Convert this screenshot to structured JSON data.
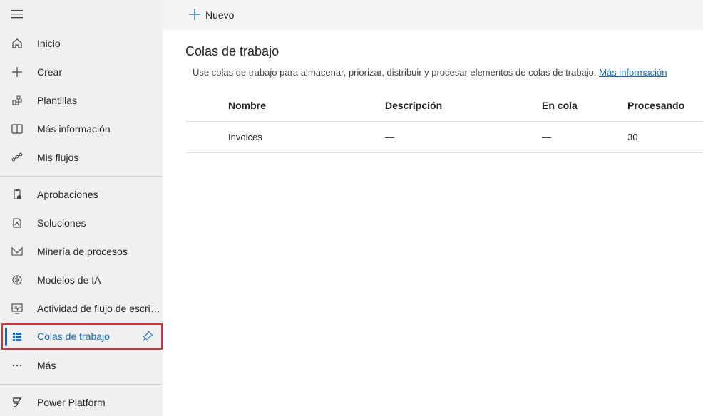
{
  "sidebar": {
    "items": [
      {
        "label": "Inicio",
        "icon": "home-icon"
      },
      {
        "label": "Crear",
        "icon": "plus-icon"
      },
      {
        "label": "Plantillas",
        "icon": "templates-icon"
      },
      {
        "label": "Más información",
        "icon": "book-icon"
      },
      {
        "label": "Mis flujos",
        "icon": "flow-icon"
      },
      {
        "label": "Aprobaciones",
        "icon": "approvals-icon"
      },
      {
        "label": "Soluciones",
        "icon": "solutions-icon"
      },
      {
        "label": "Minería de procesos",
        "icon": "process-mining-icon"
      },
      {
        "label": "Modelos de IA",
        "icon": "ai-models-icon"
      },
      {
        "label": "Actividad de flujo de escritorio",
        "icon": "desktop-activity-icon"
      },
      {
        "label": "Colas de trabajo",
        "icon": "work-queues-icon",
        "active": true
      },
      {
        "label": "Más",
        "icon": "more-icon"
      },
      {
        "label": "Power Platform",
        "icon": "power-platform-icon"
      }
    ]
  },
  "toolbar": {
    "new_label": "Nuevo"
  },
  "main": {
    "title": "Colas de trabajo",
    "description": "Use colas de trabajo para almacenar, priorizar, distribuir y procesar elementos de colas de trabajo.",
    "more_info_link": "Más información",
    "table": {
      "headers": [
        "Nombre",
        "Descripción",
        "En cola",
        "Procesando"
      ],
      "rows": [
        [
          "Invoices",
          "—",
          "—",
          "30"
        ]
      ]
    }
  },
  "colors": {
    "accent": "#0f6cbd",
    "highlight_border": "#d13438",
    "sidebar_bg": "#f0f0f0"
  }
}
